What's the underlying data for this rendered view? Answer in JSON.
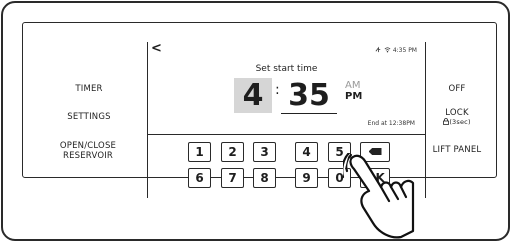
{
  "left_menu": {
    "timer": "TIMER",
    "settings": "SETTINGS",
    "open_close_line1": "OPEN/CLOSE",
    "open_close_line2": "RESERVOIR"
  },
  "right_menu": {
    "off": "OFF",
    "lock": "LOCK",
    "lock_hint": "🔒(3sec)",
    "lift_panel": "LIFT PANEL"
  },
  "screen": {
    "back": "<",
    "status_time": "4:35 PM",
    "title": "Set start time",
    "hour": "4",
    "colon": ":",
    "minute": "35",
    "am": "AM",
    "pm": "PM",
    "end_at": "End at 12:38PM"
  },
  "keypad": {
    "row1": [
      "1",
      "2",
      "3",
      "4",
      "5"
    ],
    "row2": [
      "6",
      "7",
      "8",
      "9",
      "0"
    ],
    "ok": "OK"
  }
}
